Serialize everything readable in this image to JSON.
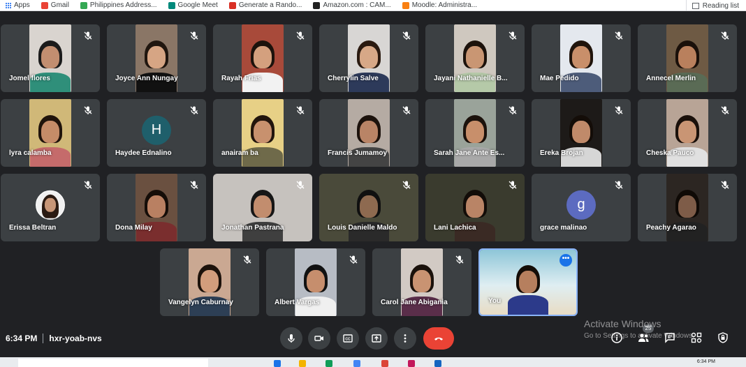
{
  "bookmarks": [
    {
      "label": "Apps",
      "icon": "apps-grid-icon",
      "color": "#4285f4"
    },
    {
      "label": "Gmail",
      "icon": "gmail-icon",
      "color": "#ea4335"
    },
    {
      "label": "Philippines Address...",
      "icon": "map-pin-icon",
      "color": "#34a853"
    },
    {
      "label": "Google Meet",
      "icon": "google-meet-icon",
      "color": "#00897b"
    },
    {
      "label": "Generate a Rando...",
      "icon": "f-logo-icon",
      "color": "#d93025"
    },
    {
      "label": "Amazon.com : CAM...",
      "icon": "amazon-icon",
      "color": "#222222"
    },
    {
      "label": "Moodle: Administra...",
      "icon": "moodle-icon",
      "color": "#f98012"
    }
  ],
  "reading_list": {
    "label": "Reading list",
    "icon": "reading-list-icon"
  },
  "participants": [
    {
      "name": "Jomel flores",
      "muted": true,
      "type": "video",
      "bg": "#d9d4cf",
      "skin": "#c28e70",
      "hair": "#1b1b1b",
      "shirt": "#2f8f7a"
    },
    {
      "name": "Joyce Ann Nungay",
      "muted": true,
      "type": "video",
      "bg": "#8a7666",
      "skin": "#d6a584",
      "hair": "#20160f",
      "shirt": "#111111"
    },
    {
      "name": "Rayah Frias",
      "muted": true,
      "type": "video",
      "bg": "#a84a3a",
      "skin": "#d4a07e",
      "hair": "#1c120c",
      "shirt": "#f2f2f2"
    },
    {
      "name": "Cherrylin Salve",
      "muted": true,
      "type": "video",
      "bg": "#d8d6d4",
      "skin": "#d7a887",
      "hair": "#2a1a10",
      "shirt": "#2d3a5a"
    },
    {
      "name": "Jayani Nathanielle B...",
      "muted": true,
      "type": "video",
      "bg": "#cfc8bf",
      "skin": "#c99673",
      "hair": "#1c120b",
      "shirt": "#b5c9a8"
    },
    {
      "name": "Mae Pedido",
      "muted": true,
      "type": "video",
      "bg": "#e4e8ee",
      "skin": "#c98f6a",
      "hair": "#20140c",
      "shirt": "#4d5c7a"
    },
    {
      "name": "Annecel Merlin",
      "muted": true,
      "type": "video",
      "bg": "#6e5a44",
      "skin": "#b9805d",
      "hair": "#1a100a",
      "shirt": "#5a6b55"
    },
    {
      "name": "lyra calamba",
      "muted": true,
      "type": "video",
      "bg": "#d0b878",
      "skin": "#c58c68",
      "hair": "#1f130b",
      "shirt": "#c56b6b"
    },
    {
      "name": "Haydee Ednalino",
      "muted": true,
      "type": "initial",
      "initial": "H",
      "color": "#1f5f6b"
    },
    {
      "name": "anairam ba",
      "muted": true,
      "type": "video",
      "bg": "#e7d086",
      "skin": "#c8916e",
      "hair": "#22150d",
      "shirt": "#6f6a4a"
    },
    {
      "name": "Francis Jumamoy",
      "muted": true,
      "type": "video",
      "bg": "#b5aba3",
      "skin": "#b98466",
      "hair": "#1c120c",
      "shirt": "#444444"
    },
    {
      "name": "Sarah Jane Ante Es...",
      "muted": true,
      "type": "video",
      "bg": "#9aa39a",
      "skin": "#c88f6b",
      "hair": "#1c120c",
      "shirt": "#a9a9a9"
    },
    {
      "name": "Ereka Brojan",
      "muted": true,
      "type": "video",
      "bg": "#1d1a18",
      "skin": "#c08a6a",
      "hair": "#140d08",
      "shirt": "#d6d6d6"
    },
    {
      "name": "Cheska Pauco",
      "muted": true,
      "type": "video",
      "bg": "#b8a496",
      "skin": "#c99574",
      "hair": "#1a100a",
      "shirt": "#e0e0e0"
    },
    {
      "name": "Erissa Beltran",
      "muted": true,
      "type": "photo"
    },
    {
      "name": "Dona Milay",
      "muted": true,
      "type": "video",
      "bg": "#6a5040",
      "skin": "#b98062",
      "hair": "#150d08",
      "shirt": "#7a2e2e"
    },
    {
      "name": "Jonathan Pastrana",
      "muted": true,
      "type": "video-wide",
      "bg": "#c6c2be",
      "skin": "#c28d6e",
      "hair": "#161616",
      "shirt": "#3f3f3f"
    },
    {
      "name": "Louis Danielle Maldo",
      "muted": true,
      "type": "video-wide",
      "bg": "#4a4a3a",
      "skin": "#8e6a50",
      "hair": "#101010",
      "shirt": "#2a2a2a"
    },
    {
      "name": "Lani Lachica",
      "muted": true,
      "type": "video-wide",
      "bg": "#3a3b2e",
      "skin": "#b98466",
      "hair": "#120c08",
      "shirt": "#3a2a24"
    },
    {
      "name": "grace malinao",
      "muted": true,
      "type": "initial",
      "initial": "g",
      "color": "#5c6bc0"
    },
    {
      "name": "Peachy Agarao",
      "muted": true,
      "type": "video",
      "bg": "#2c2622",
      "skin": "#7e5c48",
      "hair": "#0f0a06",
      "shirt": "#222222"
    },
    {
      "name": "Vangelyn Caburnay",
      "muted": true,
      "type": "video",
      "bg": "#caa892",
      "skin": "#d29d7c",
      "hair": "#1c120b",
      "shirt": "#2d3f55"
    },
    {
      "name": "Albert Vargas",
      "muted": true,
      "type": "video",
      "bg": "#b7bcc4",
      "skin": "#c68e6d",
      "hair": "#111111",
      "shirt": "#f0f0f0"
    },
    {
      "name": "Carol Jane Abigania",
      "muted": true,
      "type": "video",
      "bg": "#d2cac4",
      "skin": "#c99372",
      "hair": "#1a110b",
      "shirt": "#5a2e4a"
    },
    {
      "name": "You",
      "muted": false,
      "type": "self",
      "bg": "#8ec6d8",
      "skin": "#b67f5e",
      "hair": "#140d08",
      "shirt": "#2c3a8a"
    }
  ],
  "meeting": {
    "time": "6:34 PM",
    "code": "hxr-yoab-nvs"
  },
  "controls": [
    "microphone-icon",
    "camera-icon",
    "captions-icon",
    "present-icon",
    "more-options-icon",
    "end-call-icon"
  ],
  "right_controls": {
    "info": "info-icon",
    "people": "people-icon",
    "people_count": "25",
    "chat": "chat-icon",
    "activities": "activities-icon",
    "host_controls": "lock-icon"
  },
  "watermark": {
    "title": "Activate Windows",
    "subtitle": "Go to Settings to activate Windows."
  },
  "taskbar": {
    "clock": "6:34 PM"
  }
}
